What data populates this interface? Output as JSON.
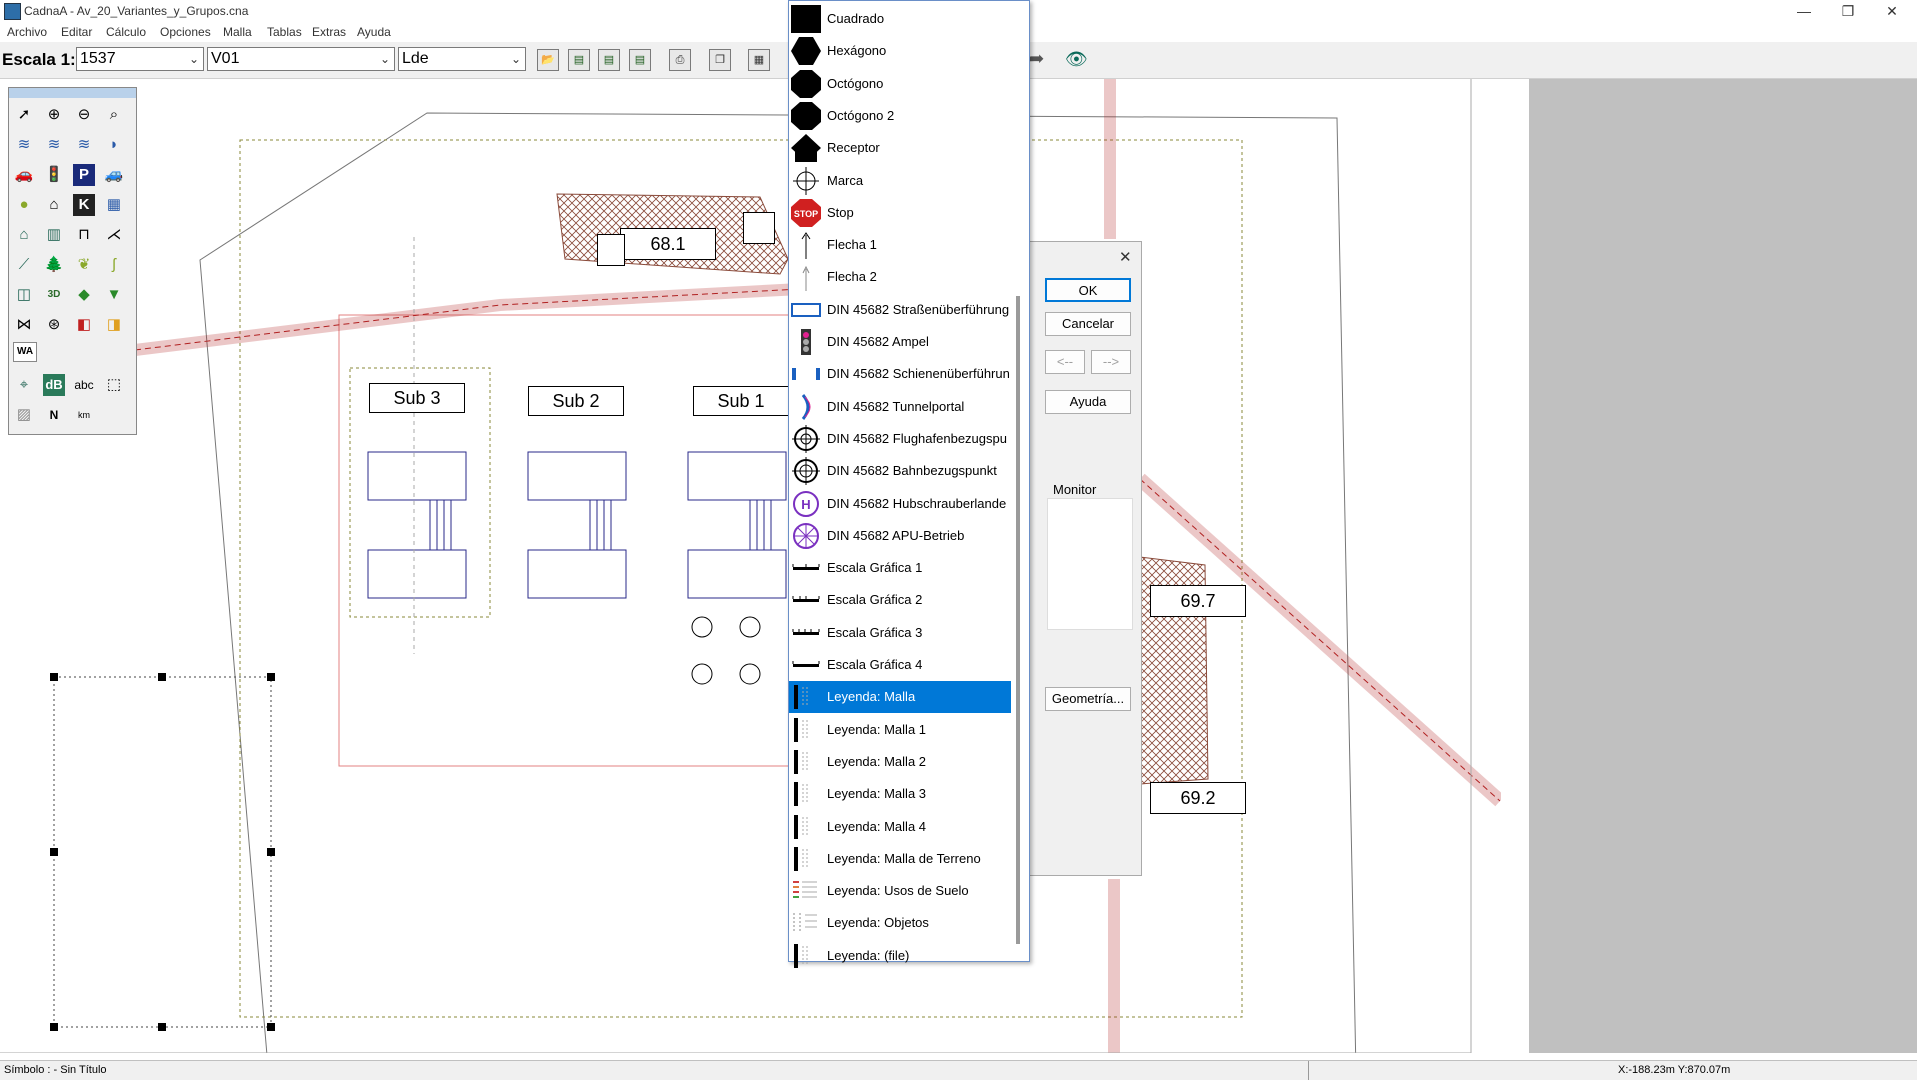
{
  "window": {
    "title": "CadnaA - Av_20_Variantes_y_Grupos.cna",
    "minimize": "—",
    "maximize": "❐",
    "close": "✕"
  },
  "menu": [
    "Archivo",
    "Editar",
    "Cálculo",
    "Opciones",
    "Malla",
    "Tablas",
    "Extras",
    "Ayuda"
  ],
  "toolbar": {
    "scale_label": "Escala 1:",
    "scale_value": "1537",
    "variant_value": "V01",
    "level_value": "Lde"
  },
  "map": {
    "sub3": "Sub 3",
    "sub2": "Sub 2",
    "sub1": "Sub 1",
    "level_68_1": "68.1",
    "level_69_7": "69.7",
    "level_69_2": "69.2",
    "wa_label": "WA"
  },
  "symbol_list": {
    "items": [
      "Cuadrado",
      "Hexágono",
      "Octógono",
      "Octógono 2",
      "Receptor",
      "Marca",
      "Stop",
      "Flecha 1",
      "Flecha 2",
      "DIN 45682 Straßenüberführung",
      "DIN 45682 Ampel",
      "DIN 45682 Schienenüberführun",
      "DIN 45682 Tunnelportal",
      "DIN 45682 Flughafenbezugspu",
      "DIN 45682 Bahnbezugspunkt",
      "DIN 45682 Hubschrauberlande",
      "DIN 45682 APU-Betrieb",
      "Escala Gráfica 1",
      "Escala Gráfica 2",
      "Escala Gráfica 3",
      "Escala Gráfica 4",
      "Leyenda: Malla",
      "Leyenda: Malla 1",
      "Leyenda: Malla 2",
      "Leyenda: Malla 3",
      "Leyenda: Malla 4",
      "Leyenda: Malla de Terreno",
      "Leyenda: Usos de Suelo",
      "Leyenda: Objetos",
      "Leyenda: (file)"
    ],
    "selected_index": 21
  },
  "dialog": {
    "ok": "OK",
    "cancel": "Cancelar",
    "prev": "<--",
    "next": "-->",
    "help": "Ayuda",
    "monitor": "Monitor",
    "geometry": "Geometría..."
  },
  "palette_text": {
    "k": "K",
    "p": "P",
    "db": "dB",
    "abc": "abc",
    "km": "km",
    "n": "N",
    "threed": "3D"
  },
  "status": {
    "left": "Símbolo : - Sin Título",
    "coords": "X:-188.23m Y:870.07m"
  },
  "colors": {
    "accent": "#0078d7",
    "road": "#b02020",
    "hatch": "#c88a6a"
  }
}
